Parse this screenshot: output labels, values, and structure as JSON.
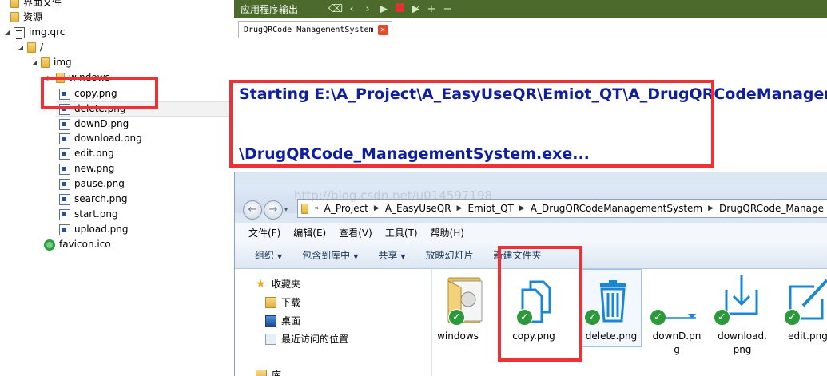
{
  "tree": {
    "rows": [
      {
        "label": "界面文件"
      },
      {
        "label": "资源"
      },
      {
        "label": "img.qrc"
      },
      {
        "label": "/"
      },
      {
        "label": "img"
      },
      {
        "label": "windows"
      },
      {
        "label": "copy.png"
      },
      {
        "label": "delete.png"
      },
      {
        "label": "downD.png"
      },
      {
        "label": "download.png"
      },
      {
        "label": "edit.png"
      },
      {
        "label": "new.png"
      },
      {
        "label": "pause.png"
      },
      {
        "label": "search.png"
      },
      {
        "label": "start.png"
      },
      {
        "label": "upload.png"
      },
      {
        "label": "favicon.ico"
      }
    ]
  },
  "output": {
    "title": "应用程序输出",
    "tab_label": "DrugQRCode_ManagementSystem",
    "close_glyph": "✕",
    "line1": "Starting E:\\A_Project\\A_EasyUseQR\\Emiot_QT\\A_DrugQRCodeManagem",
    "line2": "\\DrugQRCode_ManagementSystem.exe..."
  },
  "explorer": {
    "watermark": "http://blog.csdn.net/u014597198",
    "breadcrumb_prefix": "«",
    "breadcrumbs": [
      "A_Project",
      "A_EasyUseQR",
      "Emiot_QT",
      "A_DrugQRCodeManagementSystem",
      "DrugQRCode_Manage"
    ],
    "menu": [
      "文件(F)",
      "编辑(E)",
      "查看(V)",
      "工具(T)",
      "帮助(H)"
    ],
    "commands": [
      "组织",
      "包含到库中",
      "共享",
      "放映幻灯片",
      "新建文件夹"
    ],
    "nav": {
      "favorites": "收藏夹",
      "downloads": "下载",
      "desktop": "桌面",
      "recent": "最近访问的位置",
      "library": "库"
    },
    "files": [
      {
        "label": "windows"
      },
      {
        "label": "copy.png"
      },
      {
        "label": "delete.png"
      },
      {
        "label": "downD.pn\ng"
      },
      {
        "label": "download.\npng"
      },
      {
        "label": "edit.png"
      }
    ]
  },
  "colors": {
    "annotation_red": "#ef3034",
    "output_blue": "#0f1fa0",
    "toolbar_green": "#4c6a2b"
  }
}
